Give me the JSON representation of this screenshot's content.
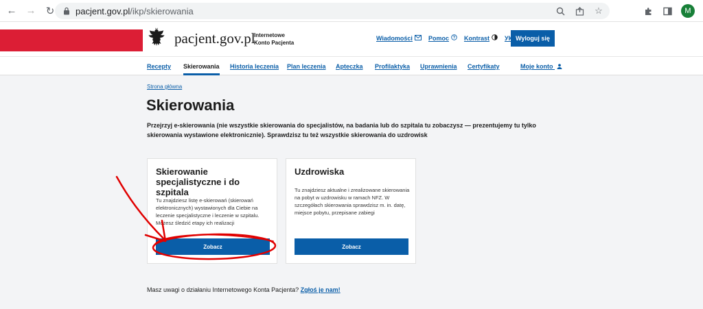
{
  "browser": {
    "url_host": "pacjent.gov.pl",
    "url_path": "/ikp/skierowania",
    "profile_initial": "M"
  },
  "header": {
    "site_name": "pacjent.gov.pl",
    "subtitle_line1": "Internetowe",
    "subtitle_line2": "Konto Pacjenta",
    "links": {
      "messages": "Wiadomości",
      "help": "Pomoc",
      "contrast": "Kontrast",
      "language": "УК"
    },
    "logout_label": "Wyloguj się",
    "brand_red": "#dc1e35",
    "brand_blue": "#0a5ea8"
  },
  "nav": {
    "recepty": "Recepty",
    "skierowania": "Skierowania",
    "historia": "Historia leczenia",
    "plan": "Plan leczenia",
    "apteczka": "Apteczka",
    "profilaktyka": "Profilaktyka",
    "uprawnienia": "Uprawnienia",
    "certyfikaty": "Certyfikaty",
    "moje_konto": "Moje konto"
  },
  "breadcrumb": "Strona główna",
  "page": {
    "title": "Skierowania",
    "intro": "Przejrzyj e-skierowania (nie wszystkie skierowania do specjalistów, na badania lub do szpitala tu zobaczysz — prezentujemy tu tylko skierowania wystawione elektronicznie). Sprawdzisz tu też wszystkie skierowania do uzdrowisk"
  },
  "cards": [
    {
      "title": "Skierowanie specjalistyczne i do szpitala",
      "description": "Tu znajdziesz listę e-skierowań (skierowań elektronicznych) wystawionych dla Ciebie na leczenie specjalistyczne i leczenie w szpitalu. Możesz śledzić etapy ich realizacji",
      "button": "Zobacz"
    },
    {
      "title": "Uzdrowiska",
      "description": "Tu znajdziesz aktualne i zrealizowane skierowania na pobyt w uzdrowisku w ramach NFZ. W szczegółach skierowania sprawdzisz m. in. datę, miejsce pobytu, przepisane zabiegi",
      "button": "Zobacz"
    }
  ],
  "feedback": {
    "text": "Masz uwagi o działaniu Internetowego Konta Pacjenta?",
    "link": "Zgłoś je nam!"
  },
  "annotation_color": "#e00000"
}
